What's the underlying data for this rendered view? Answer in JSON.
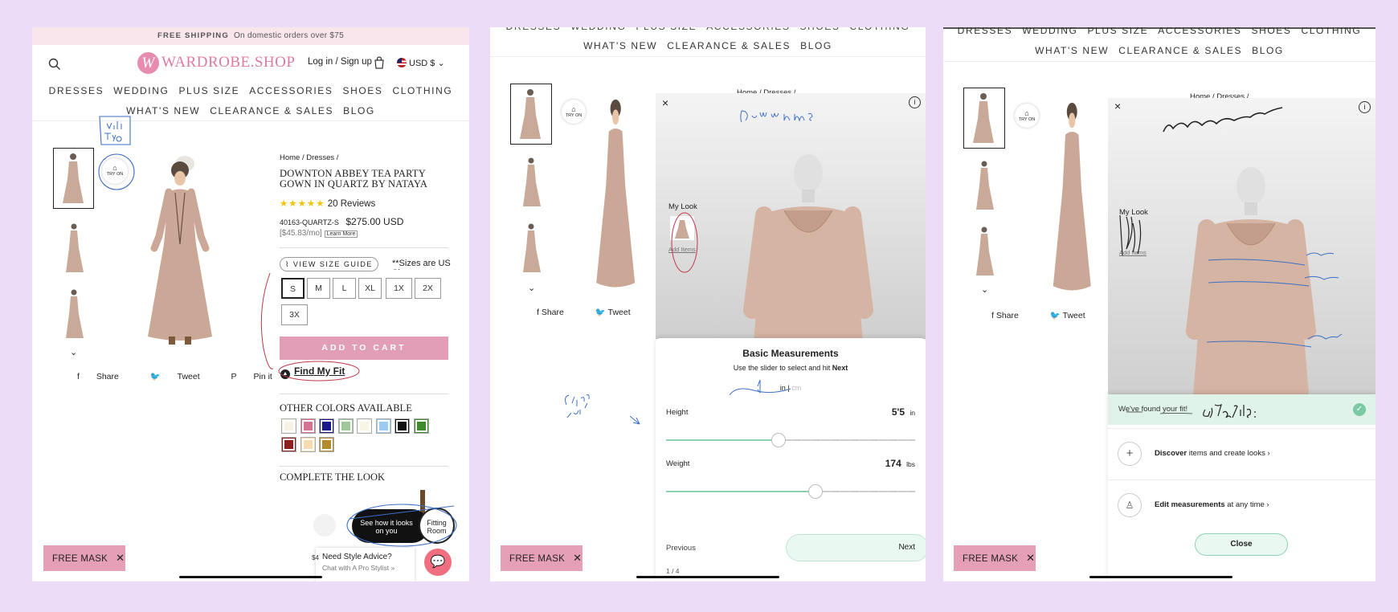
{
  "shipping": {
    "bold": "FREE SHIPPING",
    "text": "On domestic orders over $75"
  },
  "logo": {
    "mono": "W",
    "text": "WARDROBE.SHOP"
  },
  "account": {
    "login": "Log in / Sign up",
    "currency": "USD $"
  },
  "nav_row1": [
    "DRESSES",
    "WEDDING",
    "PLUS SIZE",
    "ACCESSORIES",
    "SHOES",
    "CLOTHING"
  ],
  "nav_row2": [
    "WHAT'S NEW",
    "CLEARANCE & SALES",
    "BLOG"
  ],
  "try_on": "TRY ON",
  "breadcrumb": {
    "home": "Home",
    "sep": "/",
    "dresses": "Dresses"
  },
  "product": {
    "title_l1": "DOWNTON ABBEY TEA PARTY",
    "title_l2": "GOWN IN QUARTZ BY NATAYA",
    "reviews": "20 Reviews",
    "stars": "★★★★★",
    "sku": "40163-QUARTZ-S",
    "price": "$275.00 USD",
    "monthly": "[$45.83/mo]",
    "learn": "Learn More"
  },
  "size_guide": "VIEW SIZE GUIDE",
  "size_note": "**Sizes are US Sizes",
  "sizes": [
    "S",
    "M",
    "L",
    "XL",
    "1X",
    "2X",
    "3X"
  ],
  "add_to_cart": "ADD TO CART",
  "find_fit": "Find My Fit",
  "other_colors": "OTHER COLORS AVAILABLE",
  "swatches": [
    "#f6f2e4",
    "#d3738f",
    "#1a1a8c",
    "#9fc79a",
    "#f8f4e6",
    "#9ccaf0",
    "#111111",
    "#3d8b2a",
    "#8e1f1f",
    "#f4dcb0",
    "#b38a2d"
  ],
  "complete_look": "COMPLETE THE LOOK",
  "fitting": {
    "pill": "See how it looks on you",
    "room": "Fitting Room"
  },
  "style_advice": {
    "title": "Need Style Advice?",
    "sub": "Chat with A Pro Stylist »"
  },
  "share": {
    "share": "Share",
    "tweet": "Tweet",
    "pin": "Pin it",
    "p": "P"
  },
  "mask": "FREE MASK",
  "price_partial": "$4",
  "my_look": "My Look",
  "add_items": "Add Items",
  "measure": {
    "title": "Basic Measurements",
    "hint": "Use the slider to select and hit",
    "hint_bold": "Next",
    "unit_in": "in",
    "unit_sep": "|",
    "unit_cm": "cm",
    "height_label": "Height",
    "height_value": "5'5",
    "height_unit": "in",
    "weight_label": "Weight",
    "weight_value": "174",
    "weight_unit": "lbs",
    "previous": "Previous",
    "next": "Next",
    "step": "1 / 4",
    "height_frac": 0.45,
    "weight_frac": 0.6
  },
  "result": {
    "found": "We've found your fit!",
    "discover_b": "Discover",
    "discover": "items and create looks",
    "edit_b": "Edit measurements",
    "edit": "at any time",
    "close": "Close"
  },
  "annotations": {
    "p1_note": "Virtual Try on",
    "p2_top": "Dress name",
    "p2_side": "Slider or enter?",
    "p3_mid": "Your fit is:"
  }
}
